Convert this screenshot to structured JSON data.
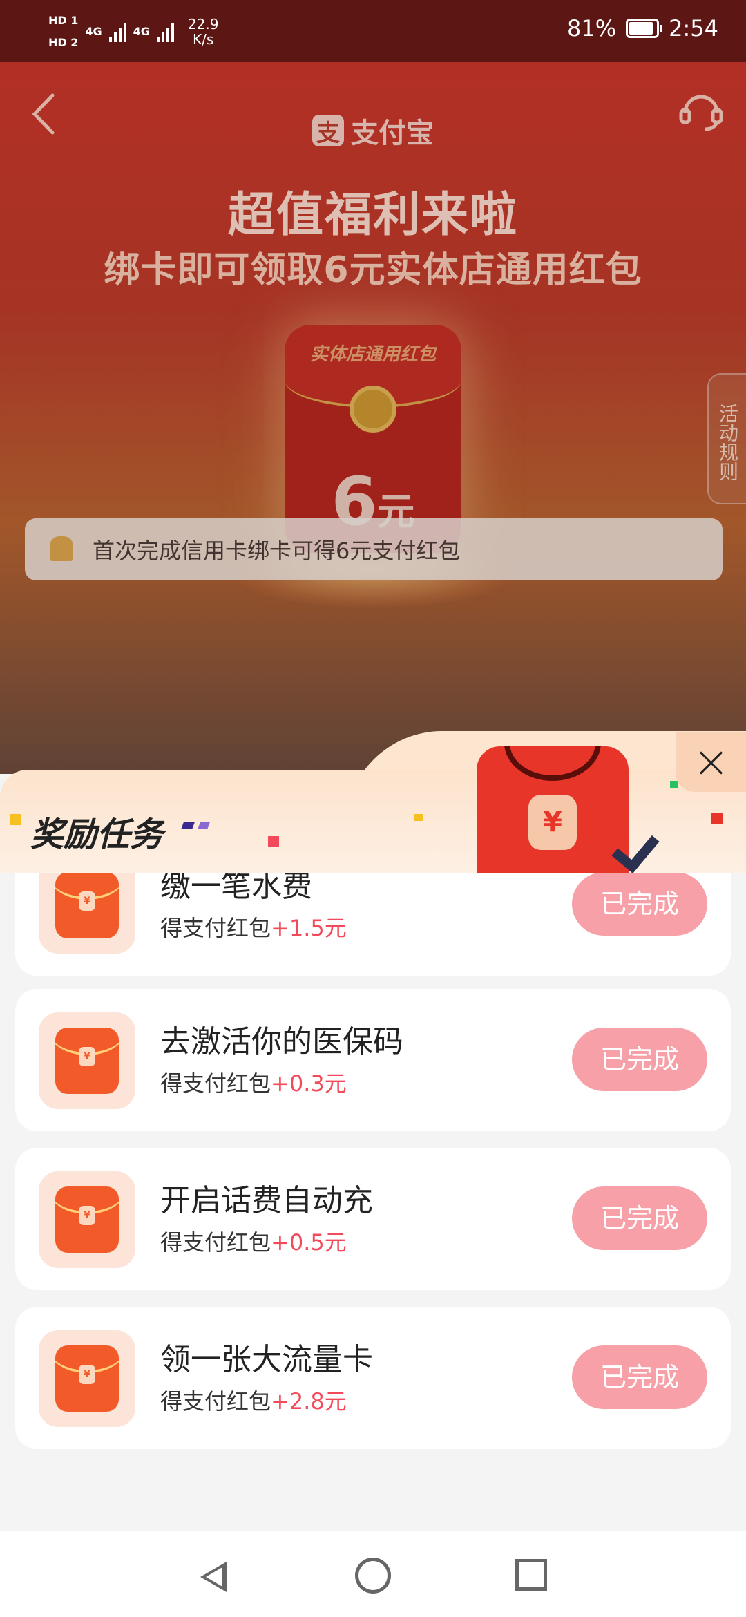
{
  "status_bar": {
    "sim1": "HD 1",
    "sim2": "HD 2",
    "net1": "4G",
    "net2": "4G",
    "speed_value": "22.9",
    "speed_unit": "K/s",
    "battery": "81%",
    "time": "2:54"
  },
  "page": {
    "brand": "支付宝",
    "headline": "超值福利来啦",
    "subline": "绑卡即可领取6元实体店通用红包",
    "envelope_label": "实体店通用红包",
    "envelope_amount": "6",
    "envelope_unit": "元",
    "rules_tab": "活动规则",
    "notice": "首次完成信用卡绑卡可得6元支付红包"
  },
  "sheet": {
    "title": "奖励任务",
    "badge_symbol": "¥",
    "tasks": [
      {
        "title": "缴一笔水费",
        "reward_label": "得支付红包",
        "reward_amount": "+1.5元",
        "button": "已完成"
      },
      {
        "title": "去激活你的医保码",
        "reward_label": "得支付红包",
        "reward_amount": "+0.3元",
        "button": "已完成"
      },
      {
        "title": "开启话费自动充",
        "reward_label": "得支付红包",
        "reward_amount": "+0.5元",
        "button": "已完成"
      },
      {
        "title": "领一张大流量卡",
        "reward_label": "得支付红包",
        "reward_amount": "+2.8元",
        "button": "已完成"
      }
    ]
  },
  "colors": {
    "accent_red": "#f24a5a",
    "done_button": "#f7a0a8",
    "status_bar_bg": "#5c1613"
  }
}
